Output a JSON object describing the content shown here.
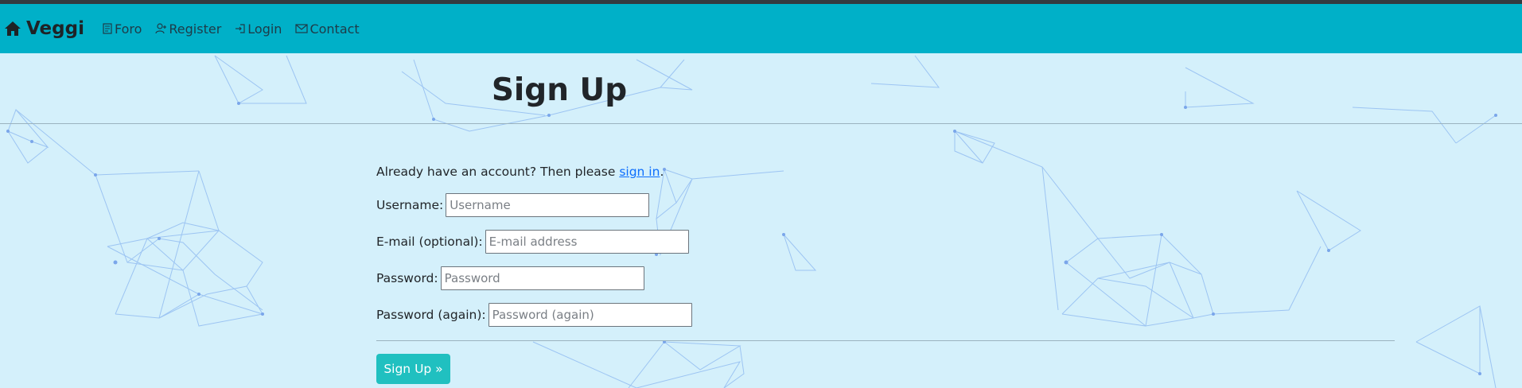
{
  "navbar": {
    "brand": "Veggi",
    "links": [
      {
        "label": "Foro",
        "icon": "forum-icon"
      },
      {
        "label": "Register",
        "icon": "register-icon"
      },
      {
        "label": "Login",
        "icon": "login-icon"
      },
      {
        "label": "Contact",
        "icon": "mail-icon"
      }
    ],
    "bg_color": "#00b0c8"
  },
  "page": {
    "title": "Sign Up",
    "intro_text": "Already have an account? Then please ",
    "intro_link": "sign in",
    "intro_end": ".",
    "background_color": "#d4f0fb"
  },
  "form": {
    "username": {
      "label": "Username:",
      "placeholder": "Username",
      "value": ""
    },
    "email": {
      "label": "E-mail (optional):",
      "placeholder": "E-mail address",
      "value": ""
    },
    "password": {
      "label": "Password:",
      "placeholder": "Password",
      "value": ""
    },
    "password2": {
      "label": "Password (again):",
      "placeholder": "Password (again)",
      "value": ""
    },
    "submit_label": "Sign Up »",
    "submit_color": "#20c0c0"
  }
}
